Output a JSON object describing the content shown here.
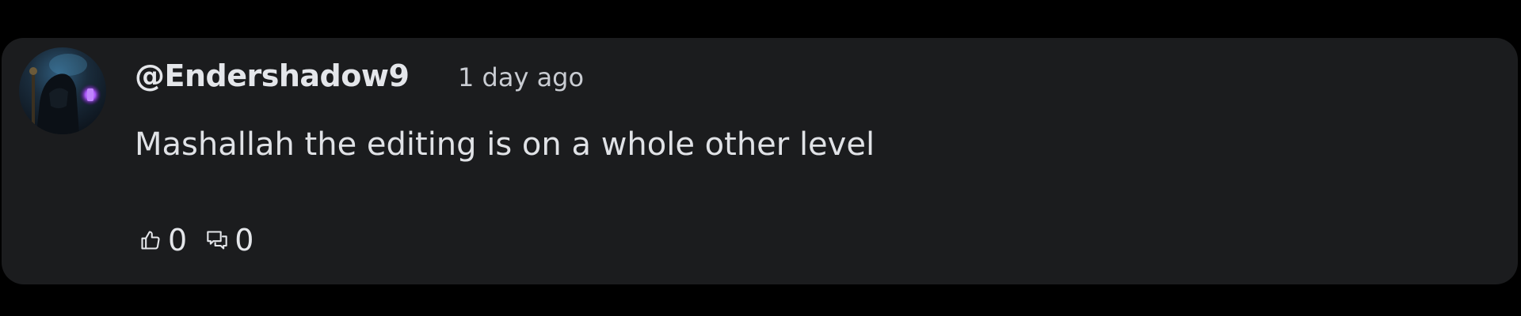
{
  "comment": {
    "author": "@Endershadow9",
    "time": "1 day ago",
    "text": "Mashallah the editing is on a whole other level",
    "likes": "0",
    "replies": "0",
    "icons": {
      "avatar": "avatar-image",
      "like": "thumbs-up-icon",
      "reply": "comments-icon"
    }
  },
  "colors": {
    "background": "#000000",
    "card": "#1b1c1e",
    "text": "#e4e6ea",
    "avatar_accent": "#a855f7"
  }
}
